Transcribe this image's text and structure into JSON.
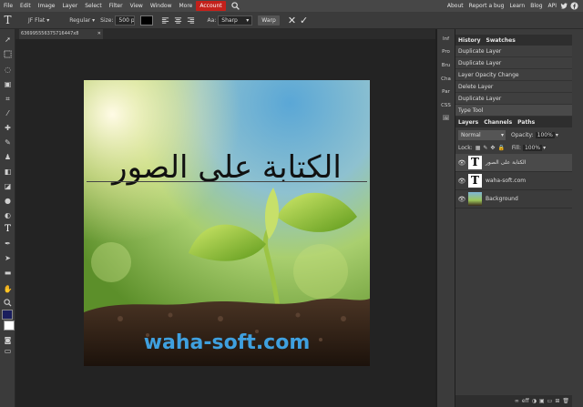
{
  "menubar": {
    "items": [
      "File",
      "Edit",
      "Image",
      "Layer",
      "Select",
      "Filter",
      "View",
      "Window",
      "More"
    ],
    "account": "Account",
    "right": [
      "About",
      "Report a bug",
      "Learn",
      "Blog",
      "API"
    ],
    "accent_color": "#c3211b"
  },
  "options": {
    "font": "JF Flat",
    "style": "Regular",
    "size_label": "Size:",
    "size_value": "500 pt",
    "aa_label": "Aa:",
    "aa_value": "Sharp",
    "warp": "Warp"
  },
  "document": {
    "tab_title": "636995556375716447x8"
  },
  "canvas": {
    "arabic_text": "الكتابة على الصور",
    "watermark": "waha-soft.com",
    "watermark_color": "#3fa0df"
  },
  "side_buttons": [
    "Inf",
    "Pro",
    "Bru",
    "Cha",
    "Par",
    "CSS"
  ],
  "history": {
    "tabs": [
      "History",
      "Swatches"
    ],
    "items": [
      "Duplicate Layer",
      "Duplicate Layer",
      "Layer Opacity Change",
      "Delete Layer",
      "Duplicate Layer",
      "Type Tool"
    ]
  },
  "layers": {
    "tabs": [
      "Layers",
      "Channels",
      "Paths"
    ],
    "blend_mode": "Normal",
    "opacity_label": "Opacity:",
    "opacity_value": "100%",
    "lock_label": "Lock:",
    "fill_label": "Fill:",
    "fill_value": "100%",
    "items": [
      "الكتابة على الصور",
      "waha-soft.com",
      "Background"
    ],
    "footer": [
      "eff"
    ]
  }
}
